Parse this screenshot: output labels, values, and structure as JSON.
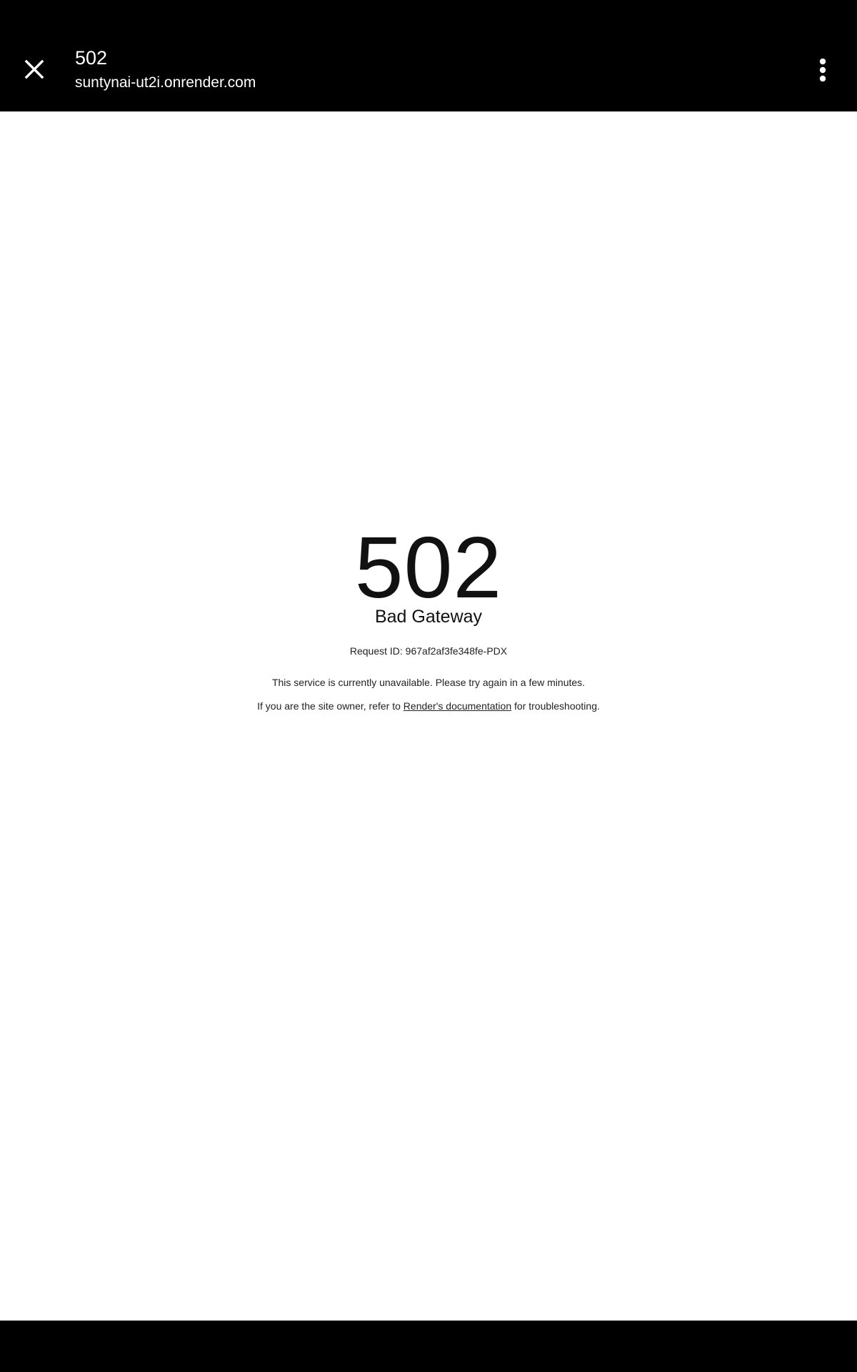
{
  "header": {
    "close_icon": "close-icon",
    "title": "502",
    "url": "suntynai-ut2i.onrender.com",
    "menu_icon": "more-vert-icon"
  },
  "error": {
    "code": "502",
    "title": "Bad Gateway",
    "request_id": "Request ID: 967af2af3fe348fe-PDX",
    "message_unavailable": "This service is currently unavailable. Please try again in a few minutes.",
    "owner_prefix": "If you are the site owner, refer to ",
    "doc_link": "Render's documentation",
    "owner_suffix": " for troubleshooting."
  },
  "colors": {
    "bar_background": "#000000",
    "page_background": "#ffffff",
    "text": "#111111"
  }
}
